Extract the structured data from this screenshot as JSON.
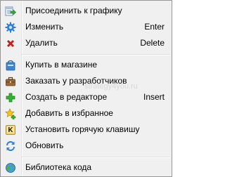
{
  "menu": {
    "items": [
      {
        "label": "Присоединить к графику",
        "shortcut": "",
        "icon": "attach-to-chart-icon"
      },
      {
        "label": "Изменить",
        "shortcut": "Enter",
        "icon": "gear-icon"
      },
      {
        "label": "Удалить",
        "shortcut": "Delete",
        "icon": "red-x-icon"
      },
      {
        "label": "Купить в магазине",
        "shortcut": "",
        "icon": "shopping-bag-icon"
      },
      {
        "label": "Заказать у разработчиков",
        "shortcut": "",
        "icon": "briefcase-icon"
      },
      {
        "label": "Создать в редакторе",
        "shortcut": "Insert",
        "icon": "green-plus-icon"
      },
      {
        "label": "Добавить в избранное",
        "shortcut": "",
        "icon": "star-add-icon"
      },
      {
        "label": "Установить горячую клавишу",
        "shortcut": "",
        "icon": "key-k-icon"
      },
      {
        "label": "Обновить",
        "shortcut": "",
        "icon": "refresh-icon"
      },
      {
        "label": "Библиотека кода",
        "shortcut": "",
        "icon": "globe-icon"
      }
    ]
  },
  "watermark": "strategy4you.ru",
  "colors": {
    "menu_background": "#f0f0f0",
    "border": "#979797",
    "separator": "#e0e0e0",
    "watermark": "#d8d8d8"
  }
}
